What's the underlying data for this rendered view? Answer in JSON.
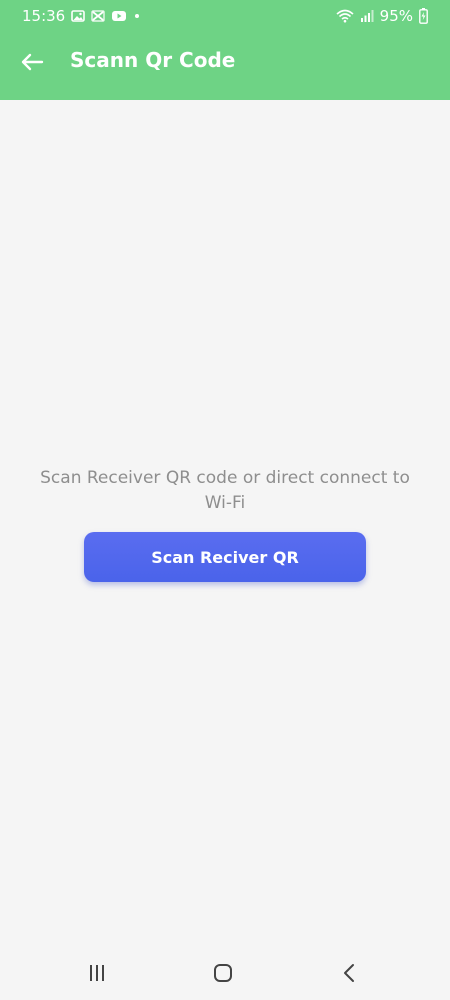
{
  "status_bar": {
    "time": "15:36",
    "notification_icons": [
      "gallery-icon",
      "capcut-icon",
      "youtube-icon",
      "dot-icon"
    ],
    "battery": "95%",
    "right_icons": [
      "wifi-icon",
      "signal-icon",
      "battery-charging-icon"
    ]
  },
  "app_bar": {
    "title": "Scann Qr Code",
    "back_icon": "arrow-left-icon"
  },
  "main": {
    "instruction": "Scan Receiver QR code or direct connect to Wi-Fi",
    "scan_button_label": "Scan Reciver QR"
  },
  "nav_bar": {
    "buttons": [
      "recents-icon",
      "home-icon",
      "back-icon"
    ]
  },
  "colors": {
    "header_green": "#6ed385",
    "button_blue": "#4f66ec",
    "background": "#f5f5f5",
    "instruction_gray": "#8e8e8e"
  }
}
